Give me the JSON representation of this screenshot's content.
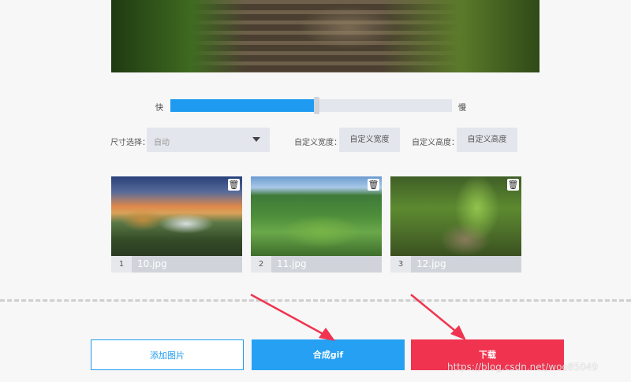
{
  "speed": {
    "fast_label": "快",
    "slow_label": "慢",
    "value_percent": 51
  },
  "options": {
    "size_label": "尺寸选择：",
    "size_selected": "自动",
    "width_label": "自定义宽度：",
    "width_placeholder": "自定义宽度",
    "height_label": "自定义高度：",
    "height_placeholder": "自定义高度"
  },
  "images": [
    {
      "index": "1",
      "name": "10.jpg"
    },
    {
      "index": "2",
      "name": "11.jpg"
    },
    {
      "index": "3",
      "name": "12.jpg"
    }
  ],
  "icons": {
    "delete": "trash-icon",
    "select_caret": "caret-down-icon"
  },
  "buttons": {
    "add_image": "添加图片",
    "make_gif": "合成gif",
    "download": "下载"
  },
  "colors": {
    "primary": "#1e9bf0",
    "danger": "#f0344f",
    "annotation_arrow": "#f0344f"
  },
  "watermark": "https://blog.csdn.net/woo85049"
}
